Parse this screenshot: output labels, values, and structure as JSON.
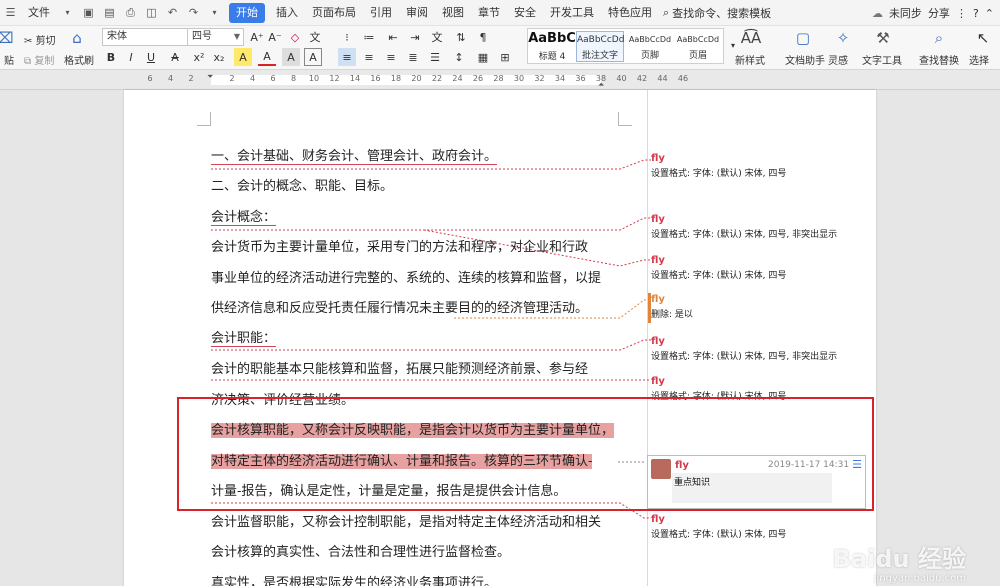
{
  "menu": {
    "file": "文件",
    "tabs": [
      "开始",
      "插入",
      "页面布局",
      "引用",
      "审阅",
      "视图",
      "章节",
      "安全",
      "开发工具",
      "特色应用"
    ],
    "search": "查找命令、搜索模板",
    "sync": "未同步",
    "share": "分享"
  },
  "ribbon": {
    "paste_label": "贴",
    "cut": "剪切",
    "copy": "复制",
    "format_painter": "格式刷",
    "font_name": "宋体",
    "font_size": "四号",
    "styles": [
      {
        "preview": "AaBbC",
        "name": "标题 4"
      },
      {
        "preview": "AaBbCcDd",
        "name": "批注文字"
      },
      {
        "preview": "AaBbCcDd",
        "name": "页脚"
      },
      {
        "preview": "AaBbCcDd",
        "name": "页眉"
      }
    ],
    "new_style": "新样式",
    "doc_assistant": "文档助手",
    "inspiration": "灵感",
    "text_tools": "文字工具",
    "find_replace": "查找替换",
    "select": "选择"
  },
  "ruler": {
    "numbers": [
      "6",
      "4",
      "2",
      "",
      "2",
      "4",
      "6",
      "8",
      "10",
      "12",
      "14",
      "16",
      "18",
      "20",
      "22",
      "24",
      "26",
      "28",
      "30",
      "32",
      "34",
      "36",
      "38",
      "40",
      "42",
      "44",
      "46"
    ]
  },
  "document": {
    "lines": [
      {
        "text": "一、会计基础、财务会计、管理会计、政府会计。",
        "style": "ins"
      },
      {
        "text": "二、会计的概念、职能、目标。",
        "style": ""
      },
      {
        "text": "会计概念：",
        "style": "ins"
      },
      {
        "text": "    会计货币为主要计量单位，采用专门的方法和程序，对企业和行政",
        "style": ""
      },
      {
        "text": "事业单位的经济活动进行完整的、系统的、连续的核算和监督，以提",
        "style": ""
      },
      {
        "text": "供经济信息和反应受托责任履行情况未主要目的的经济管理活动。",
        "style": ""
      },
      {
        "text": "会计职能：",
        "style": "ins"
      },
      {
        "text": "    会计的职能基本只能核算和监督，拓展只能预测经济前景、参与经",
        "style": ""
      },
      {
        "text": "济决策、评价经营业绩。",
        "style": ""
      },
      {
        "text": "会计核算职能，又称会计反映职能，是指会计以货币为主要计量单位，",
        "style": "hl"
      },
      {
        "text": "对特定主体的经济活动进行确认、计量和报告。核算的三环节确认-",
        "style": "hl"
      },
      {
        "text": "计量-报告，确认是定性，计量是定量，报告是提供会计信息。",
        "style": ""
      },
      {
        "text": "会计监督职能，又称会计控制职能，是指对特定主体经济活动和相关",
        "style": ""
      },
      {
        "text": "会计核算的真实性、合法性和合理性进行监督检查。",
        "style": ""
      },
      {
        "text": "真实性，是否根据实际发生的经济业务事项进行。",
        "style": ""
      }
    ]
  },
  "comments": [
    {
      "author": "fly",
      "text": "设置格式: 字体: (默认) 宋体, 四号"
    },
    {
      "author": "fly",
      "text": "设置格式: 字体: (默认) 宋体, 四号, 非突出显示"
    },
    {
      "author": "fly",
      "text": "设置格式: 字体: (默认) 宋体, 四号"
    },
    {
      "author": "fly",
      "text": "删除: 是以"
    },
    {
      "author": "fly",
      "text": "设置格式: 字体: (默认) 宋体, 四号, 非突出显示"
    },
    {
      "author": "fly",
      "text": "设置格式: 字体: (默认) 宋体, 四号"
    },
    {
      "author": "fly",
      "text": "设置格式: 字体: (默认) 宋体, 四号"
    }
  ],
  "comment_card": {
    "author": "fly",
    "date": "2019-11-17 14:31",
    "text": "重点知识"
  },
  "watermark": {
    "logo": "Baidu 经验",
    "url": "jingyan.baidu.com"
  },
  "colors": {
    "accent": "#3a7de8",
    "highlight": "#e7a1a1",
    "revision": "#d23c4c",
    "annotation_box": "#d9232b"
  }
}
